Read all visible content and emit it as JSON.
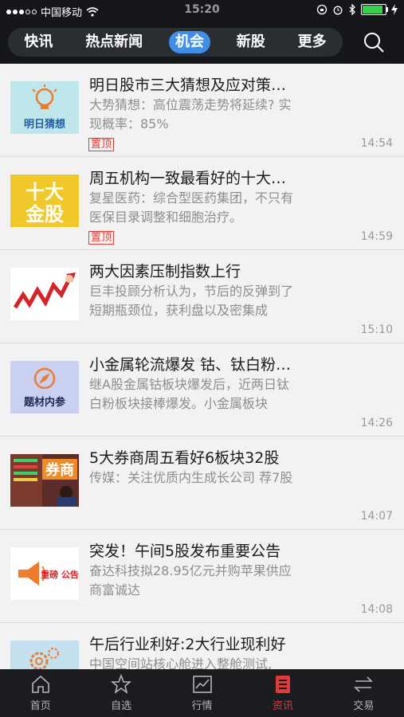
{
  "status_bar": {
    "carrier": "中国移动",
    "time": "15:20",
    "battery_level": 0.95,
    "icons": [
      "signal-dots-icon",
      "wifi-icon",
      "lock-rotation-icon",
      "alarm-icon",
      "bluetooth-icon",
      "battery-icon",
      "charging-icon"
    ]
  },
  "top_nav": {
    "tabs": [
      {
        "label": "快讯",
        "active": false
      },
      {
        "label": "热点新闻",
        "active": false
      },
      {
        "label": "机会",
        "active": true
      },
      {
        "label": "新股",
        "active": false
      },
      {
        "label": "更多",
        "active": false
      }
    ],
    "search_icon": "search-icon"
  },
  "articles": [
    {
      "title": "明日股市三大猜想及应对策…",
      "summary": "大势猜想：高位震荡走势将延续? 实现概率：85%",
      "pinned_label": "置顶",
      "time": "14:54",
      "thumb_text": "明日猜想",
      "thumb": "lightbulb"
    },
    {
      "title": "周五机构一致最看好的十大…",
      "summary": "复星医药：综合型医药集团，不只有医保目录调整和细胞治疗。",
      "pinned_label": "置顶",
      "time": "14:59",
      "thumb_text": "十大 金股",
      "thumb": "gold"
    },
    {
      "title": "两大因素压制指数上行",
      "summary": "巨丰投顾分析认为，节后的反弹到了短期瓶颈位，获利盘以及密集成",
      "pinned_label": "",
      "time": "15:10",
      "thumb_text": "",
      "thumb": "arrow"
    },
    {
      "title": "小金属轮流爆发 钴、钛白粉…",
      "summary": "继A股金属钴板块爆发后，近两日钛白粉板块接棒爆发。小金属板块",
      "pinned_label": "",
      "time": "14:26",
      "thumb_text": "题材内参",
      "thumb": "compass"
    },
    {
      "title": "5大券商周五看好6板块32股",
      "summary": "传媒：关注优质内生成长公司 荐7股",
      "pinned_label": "",
      "time": "14:07",
      "thumb_text": "券商",
      "thumb": "broker"
    },
    {
      "title": "突发！午间5股发布重要公告",
      "summary": "奋达科技拟28.95亿元并购苹果供应商富诚达",
      "pinned_label": "",
      "time": "14:08",
      "thumb_text": "重磅 公告",
      "thumb": "megaphone"
    },
    {
      "title": "午后行业利好:2大行业现利好",
      "summary": "中国空间站核心舱进入整舱测试,",
      "pinned_label": "",
      "time": "",
      "thumb_text": "",
      "thumb": "gears"
    }
  ],
  "bottom_nav": [
    {
      "label": "首页",
      "icon": "home-icon",
      "active": false
    },
    {
      "label": "自选",
      "icon": "star-icon",
      "active": false
    },
    {
      "label": "行情",
      "icon": "chart-icon",
      "active": false
    },
    {
      "label": "资讯",
      "icon": "news-icon",
      "active": true
    },
    {
      "label": "交易",
      "icon": "trade-icon",
      "active": false
    }
  ],
  "colors": {
    "accent": "#3f8fe8",
    "active_red": "#e23a3a",
    "pin_red": "#e43b3b"
  }
}
